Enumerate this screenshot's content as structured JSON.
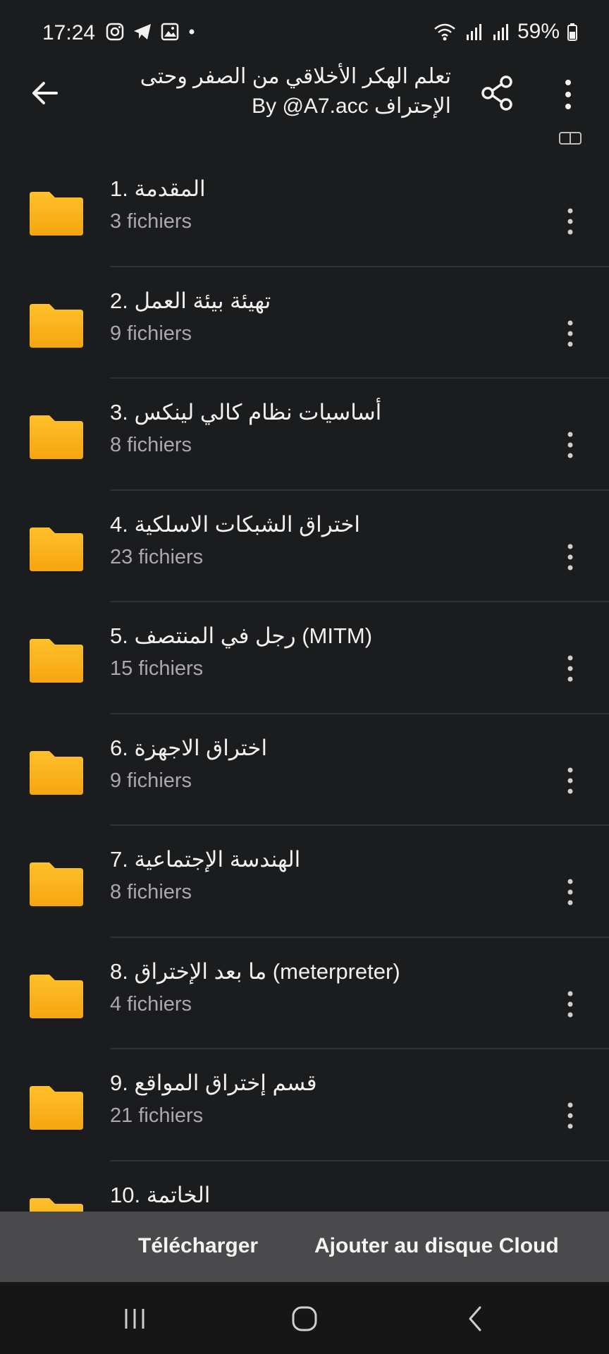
{
  "status_bar": {
    "time": "17:24",
    "battery": "59%",
    "icons": [
      "instagram-icon",
      "telegram-icon",
      "gallery-icon",
      "dot-icon",
      "wifi-icon",
      "signal-icon",
      "signal-icon",
      "battery-icon"
    ]
  },
  "header": {
    "title_line1": "تعلم الهكر الأخلاقي من الصفر وحتى",
    "title_line2": "الإحتراف By @A7.acc"
  },
  "folders": [
    {
      "name": "1. المقدمة",
      "count": "3 fichiers"
    },
    {
      "name": "2. تهيئة بيئة العمل",
      "count": "9 fichiers"
    },
    {
      "name": "3. أساسيات نظام كالي لينكس",
      "count": "8 fichiers"
    },
    {
      "name": "4. اختراق الشبكات الاسلكية",
      "count": "23 fichiers"
    },
    {
      "name": "5. رجل في المنتصف (MITM)",
      "count": "15 fichiers"
    },
    {
      "name": "6. اختراق الاجهزة",
      "count": "9 fichiers"
    },
    {
      "name": "7. الهندسة الإجتماعية",
      "count": "8 fichiers"
    },
    {
      "name": "8. ما بعد الإختراق (meterpreter)",
      "count": "4 fichiers"
    },
    {
      "name": "9. قسم إختراق المواقع",
      "count": "21 fichiers"
    },
    {
      "name": "10. الخاتمة",
      "count": ""
    }
  ],
  "actions": {
    "download": "Télécharger",
    "cloud": "Ajouter au disque Cloud"
  },
  "colors": {
    "background": "#1b1c1e",
    "folder": "#f7b21a",
    "action_bar": "#4a4a4c"
  }
}
